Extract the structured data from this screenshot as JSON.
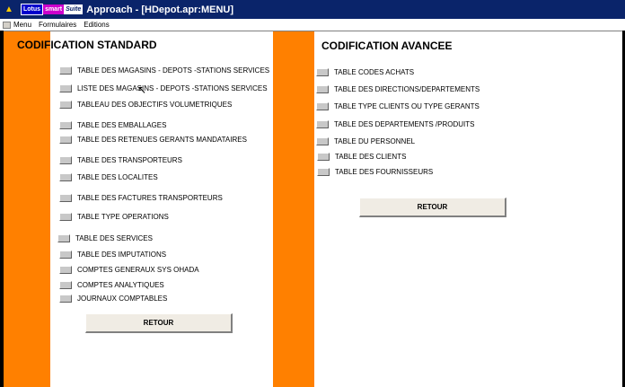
{
  "window": {
    "brand_1": "Lotus",
    "brand_2": "smart",
    "brand_3": "Suite",
    "title": "Approach - [HDepot.apr:MENU]"
  },
  "menu": {
    "items": [
      "Menu",
      "Formulaires",
      "Editions"
    ]
  },
  "standard": {
    "heading": "CODIFICATION STANDARD",
    "items": [
      "TABLE DES MAGASINS - DEPOTS -STATIONS SERVICES",
      "LISTE DES MAGASINS - DEPOTS -STATIONS SERVICES",
      "TABLEAU DES OBJECTIFS VOLUMETRIQUES",
      "TABLE DES EMBALLAGES",
      "TABLE DES RETENUES GERANTS MANDATAIRES",
      "TABLE DES TRANSPORTEURS",
      "TABLE DES LOCALITES",
      "TABLE  DES FACTURES TRANSPORTEURS",
      "TABLE TYPE OPERATIONS",
      "TABLE DES SERVICES",
      "TABLE DES IMPUTATIONS",
      "COMPTES GENERAUX SYS OHADA",
      "COMPTES ANALYTIQUES",
      "JOURNAUX COMPTABLES"
    ],
    "retour": "RETOUR"
  },
  "avancee": {
    "heading": "CODIFICATION AVANCEE",
    "items": [
      "TABLE CODES ACHATS",
      "TABLE DES DIRECTIONS/DEPARTEMENTS",
      "TABLE TYPE CLIENTS OU TYPE GERANTS",
      "TABLE DES DEPARTEMENTS /PRODUITS",
      "TABLE DU PERSONNEL",
      "TABLE DES CLIENTS",
      "TABLE DES FOURNISSEURS"
    ],
    "retour": "RETOUR"
  }
}
